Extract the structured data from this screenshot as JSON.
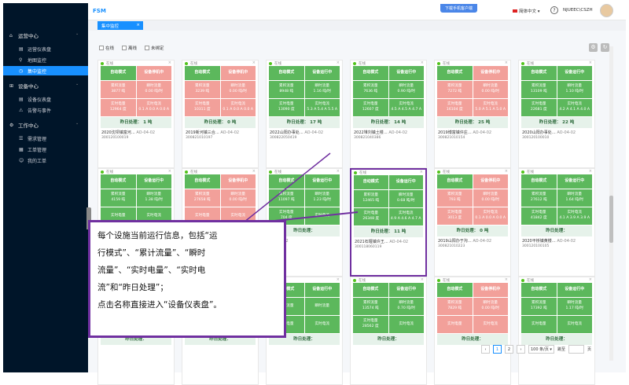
{
  "app": {
    "title": "FSM",
    "download_label": "下载手机客户端",
    "lang_label": "简体中文",
    "user": "NJUEEC\\CSZH"
  },
  "sidebar": {
    "items": [
      {
        "label": "运营中心",
        "type": "group",
        "icon": "home-icon"
      },
      {
        "label": "运营仪表盘",
        "type": "sub",
        "icon": "dashboard-icon"
      },
      {
        "label": "地图监控",
        "type": "sub",
        "icon": "map-icon"
      },
      {
        "label": "集中监控",
        "type": "active",
        "icon": "monitor-icon"
      },
      {
        "label": "设备中心",
        "type": "group",
        "icon": "device-icon"
      },
      {
        "label": "设备仪表盘",
        "type": "sub",
        "icon": "dashboard-icon"
      },
      {
        "label": "告警与事件",
        "type": "sub",
        "icon": "alarm-icon"
      },
      {
        "label": "工作中心",
        "type": "group",
        "icon": "work-icon"
      },
      {
        "label": "需求管理",
        "type": "sub",
        "icon": "list-icon"
      },
      {
        "label": "工单管理",
        "type": "sub",
        "icon": "ticket-icon"
      },
      {
        "label": "我的工单",
        "type": "sub",
        "icon": "user-icon"
      }
    ]
  },
  "tabs": [
    {
      "label": "集中监控"
    }
  ],
  "filters": [
    {
      "label": "在线"
    },
    {
      "label": "离线"
    },
    {
      "label": "未绑定"
    }
  ],
  "labels": {
    "online": "在线",
    "auto": "自动模式",
    "running": "设备运行中",
    "stopped": "设备停机中",
    "cum": "累积流量",
    "inst": "瞬时流量",
    "power": "实时电量",
    "current": "实时电流",
    "yesterday": "昨日处理："
  },
  "cards": [
    {
      "status": "stopped",
      "cum": "3877 吨",
      "inst": "0.00 吨/时",
      "power": "12964 度",
      "current": "0.1 A 0.0 A 0.0 A",
      "yesterday": "1 吨",
      "name": "2020沈坝镇富河…",
      "model": "AO-04-02",
      "id": "300120100019"
    },
    {
      "status": "stopped",
      "cum": "3239 吨",
      "inst": "0.00 吨/时",
      "power": "10311 度",
      "current": "0.1 A 0.0 A 0.0 A",
      "yesterday": "0 吨",
      "name": "2019新河镇三合…",
      "model": "AO-04-02",
      "id": "300821010197"
    },
    {
      "status": "running",
      "cum": "8948 吨",
      "inst": "1.16 吨/时",
      "power": "13090 度",
      "current": "5.3 A 5.4 A 5.5 A",
      "yesterday": "17 吨",
      "name": "2022山阳办事处…",
      "model": "AO-04-02",
      "id": "300822050419"
    },
    {
      "status": "running",
      "cum": "7636 吨",
      "inst": "0.90 吨/时",
      "power": "12607 度",
      "current": "4.5 A 4.5 A 4.7 A",
      "yesterday": "14 吨",
      "name": "2022堆刘镇土楼…",
      "model": "AO-04-02",
      "id": "300821040386"
    },
    {
      "status": "stopped",
      "cum": "7272 吨",
      "inst": "0.00 吨/时",
      "power": "16104 度",
      "current": "5.0 A 5.1 A 5.0 A",
      "yesterday": "25 吨",
      "name": "2019博富镇许庄…",
      "model": "AO-04-02",
      "id": "300821010154"
    },
    {
      "status": "running",
      "cum": "13109 吨",
      "inst": "1.10 吨/时",
      "power": "22681 度",
      "current": "4.2 A 4.1 A 4.0 A",
      "yesterday": "22 吨",
      "name": "2020山阳办事处…",
      "model": "AO-04-02",
      "id": "300120100010"
    },
    {
      "status": "running",
      "cum": "4159 吨",
      "inst": "1.38 吨/时",
      "power": "",
      "current": "",
      "yesterday": "",
      "name": "",
      "model": "",
      "id": ""
    },
    {
      "status": "stopped",
      "cum": "27658 吨",
      "inst": "0.00 吨/时",
      "power": "",
      "current": "",
      "yesterday": "",
      "name": "",
      "model": "",
      "id": ""
    },
    {
      "status": "running",
      "cum": "11097 吨",
      "inst": "1.23 吨/时",
      "power": "704 度",
      "current": "",
      "yesterday": "",
      "name": "",
      "model": "AO-04-02",
      "id": "0013"
    },
    {
      "status": "running",
      "cum": "12465 吨",
      "inst": "0.68 吨/时",
      "power": "26348 度",
      "current": "4.9 A 4.6 A 4.7 A",
      "yesterday": "11 吨",
      "name": "2021石堰镇许王…",
      "model": "AO-04-02",
      "id": "300118060119"
    },
    {
      "status": "stopped",
      "cum": "793 吨",
      "inst": "0.00 吨/时",
      "power": "3013 度",
      "current": "0.1 A 0.0 A 0.0 A",
      "yesterday": "0 吨",
      "name": "2019山阳办于沟…",
      "model": "AO-04-02",
      "id": "300821010223"
    },
    {
      "status": "running",
      "cum": "27612 吨",
      "inst": "1.64 吨/时",
      "power": "41842 度",
      "current": "4.1 A 3.9 A 3.9 A",
      "yesterday": "",
      "name": "2020平桥镇黄楼…",
      "model": "AO-04-02",
      "id": "300120100105"
    },
    {
      "status": "running",
      "cum": "",
      "inst": "",
      "power": "",
      "current": "",
      "yesterday": "",
      "name": "",
      "model": "",
      "id": ""
    },
    {
      "status": "stopped",
      "cum": "54 吨",
      "inst": "0.00 吨/时",
      "power": "",
      "current": "",
      "yesterday": "",
      "name": "",
      "model": "",
      "id": ""
    },
    {
      "status": "running",
      "cum": "",
      "inst": "",
      "power": "",
      "current": "",
      "yesterday": "",
      "name": "",
      "model": "",
      "id": ""
    },
    {
      "status": "running",
      "cum": "13574 吨",
      "inst": "0.70 吨/时",
      "power": "28562 度",
      "current": "",
      "yesterday": "",
      "name": "",
      "model": "",
      "id": ""
    },
    {
      "status": "stopped",
      "cum": "7829 吨",
      "inst": "0.00 吨/时",
      "power": "",
      "current": "",
      "yesterday": "",
      "name": "",
      "model": "",
      "id": ""
    },
    {
      "status": "running",
      "cum": "17392 吨",
      "inst": "1.17 吨/时",
      "power": "",
      "current": "",
      "yesterday": "",
      "name": "",
      "model": "",
      "id": ""
    }
  ],
  "pagination": {
    "prev": "‹",
    "pages": [
      "1",
      "2"
    ],
    "next": "›",
    "size": "100 条/页",
    "goto": "跳至",
    "page_unit": "页"
  },
  "annotation": {
    "lines": [
      "每个设施当前运行信息，包括“运",
      "行模式”、“累计流量”、“瞬时",
      "流量”、“实时电量”、“实时电",
      "流”和“昨日处理”；",
      "点击名称直接进入“设备仪表盘”。"
    ]
  }
}
